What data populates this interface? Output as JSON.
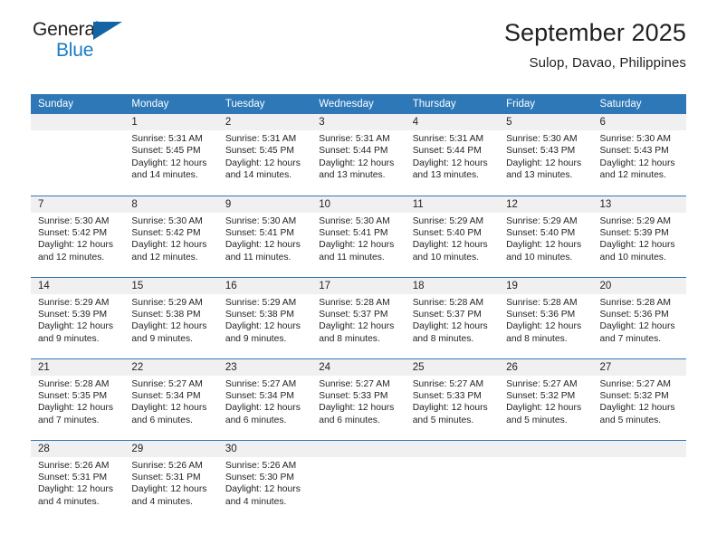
{
  "brand": {
    "name_part1": "General",
    "name_part2": "Blue",
    "triangle_icon": "triangle-icon",
    "accent_color": "#1a7dc4",
    "triangle_color": "#1464a5"
  },
  "header": {
    "title": "September 2025",
    "subtitle": "Sulop, Davao, Philippines"
  },
  "calendar": {
    "header_bg": "#2e78b8",
    "daynum_bg": "#f0f0f0",
    "weekday_headers": [
      "Sunday",
      "Monday",
      "Tuesday",
      "Wednesday",
      "Thursday",
      "Friday",
      "Saturday"
    ],
    "weeks": [
      [
        {
          "day": "",
          "sunrise": "",
          "sunset": "",
          "daylight": "",
          "daylight2": ""
        },
        {
          "day": "1",
          "sunrise": "Sunrise: 5:31 AM",
          "sunset": "Sunset: 5:45 PM",
          "daylight": "Daylight: 12 hours",
          "daylight2": "and 14 minutes."
        },
        {
          "day": "2",
          "sunrise": "Sunrise: 5:31 AM",
          "sunset": "Sunset: 5:45 PM",
          "daylight": "Daylight: 12 hours",
          "daylight2": "and 14 minutes."
        },
        {
          "day": "3",
          "sunrise": "Sunrise: 5:31 AM",
          "sunset": "Sunset: 5:44 PM",
          "daylight": "Daylight: 12 hours",
          "daylight2": "and 13 minutes."
        },
        {
          "day": "4",
          "sunrise": "Sunrise: 5:31 AM",
          "sunset": "Sunset: 5:44 PM",
          "daylight": "Daylight: 12 hours",
          "daylight2": "and 13 minutes."
        },
        {
          "day": "5",
          "sunrise": "Sunrise: 5:30 AM",
          "sunset": "Sunset: 5:43 PM",
          "daylight": "Daylight: 12 hours",
          "daylight2": "and 13 minutes."
        },
        {
          "day": "6",
          "sunrise": "Sunrise: 5:30 AM",
          "sunset": "Sunset: 5:43 PM",
          "daylight": "Daylight: 12 hours",
          "daylight2": "and 12 minutes."
        }
      ],
      [
        {
          "day": "7",
          "sunrise": "Sunrise: 5:30 AM",
          "sunset": "Sunset: 5:42 PM",
          "daylight": "Daylight: 12 hours",
          "daylight2": "and 12 minutes."
        },
        {
          "day": "8",
          "sunrise": "Sunrise: 5:30 AM",
          "sunset": "Sunset: 5:42 PM",
          "daylight": "Daylight: 12 hours",
          "daylight2": "and 12 minutes."
        },
        {
          "day": "9",
          "sunrise": "Sunrise: 5:30 AM",
          "sunset": "Sunset: 5:41 PM",
          "daylight": "Daylight: 12 hours",
          "daylight2": "and 11 minutes."
        },
        {
          "day": "10",
          "sunrise": "Sunrise: 5:30 AM",
          "sunset": "Sunset: 5:41 PM",
          "daylight": "Daylight: 12 hours",
          "daylight2": "and 11 minutes."
        },
        {
          "day": "11",
          "sunrise": "Sunrise: 5:29 AM",
          "sunset": "Sunset: 5:40 PM",
          "daylight": "Daylight: 12 hours",
          "daylight2": "and 10 minutes."
        },
        {
          "day": "12",
          "sunrise": "Sunrise: 5:29 AM",
          "sunset": "Sunset: 5:40 PM",
          "daylight": "Daylight: 12 hours",
          "daylight2": "and 10 minutes."
        },
        {
          "day": "13",
          "sunrise": "Sunrise: 5:29 AM",
          "sunset": "Sunset: 5:39 PM",
          "daylight": "Daylight: 12 hours",
          "daylight2": "and 10 minutes."
        }
      ],
      [
        {
          "day": "14",
          "sunrise": "Sunrise: 5:29 AM",
          "sunset": "Sunset: 5:39 PM",
          "daylight": "Daylight: 12 hours",
          "daylight2": "and 9 minutes."
        },
        {
          "day": "15",
          "sunrise": "Sunrise: 5:29 AM",
          "sunset": "Sunset: 5:38 PM",
          "daylight": "Daylight: 12 hours",
          "daylight2": "and 9 minutes."
        },
        {
          "day": "16",
          "sunrise": "Sunrise: 5:29 AM",
          "sunset": "Sunset: 5:38 PM",
          "daylight": "Daylight: 12 hours",
          "daylight2": "and 9 minutes."
        },
        {
          "day": "17",
          "sunrise": "Sunrise: 5:28 AM",
          "sunset": "Sunset: 5:37 PM",
          "daylight": "Daylight: 12 hours",
          "daylight2": "and 8 minutes."
        },
        {
          "day": "18",
          "sunrise": "Sunrise: 5:28 AM",
          "sunset": "Sunset: 5:37 PM",
          "daylight": "Daylight: 12 hours",
          "daylight2": "and 8 minutes."
        },
        {
          "day": "19",
          "sunrise": "Sunrise: 5:28 AM",
          "sunset": "Sunset: 5:36 PM",
          "daylight": "Daylight: 12 hours",
          "daylight2": "and 8 minutes."
        },
        {
          "day": "20",
          "sunrise": "Sunrise: 5:28 AM",
          "sunset": "Sunset: 5:36 PM",
          "daylight": "Daylight: 12 hours",
          "daylight2": "and 7 minutes."
        }
      ],
      [
        {
          "day": "21",
          "sunrise": "Sunrise: 5:28 AM",
          "sunset": "Sunset: 5:35 PM",
          "daylight": "Daylight: 12 hours",
          "daylight2": "and 7 minutes."
        },
        {
          "day": "22",
          "sunrise": "Sunrise: 5:27 AM",
          "sunset": "Sunset: 5:34 PM",
          "daylight": "Daylight: 12 hours",
          "daylight2": "and 6 minutes."
        },
        {
          "day": "23",
          "sunrise": "Sunrise: 5:27 AM",
          "sunset": "Sunset: 5:34 PM",
          "daylight": "Daylight: 12 hours",
          "daylight2": "and 6 minutes."
        },
        {
          "day": "24",
          "sunrise": "Sunrise: 5:27 AM",
          "sunset": "Sunset: 5:33 PM",
          "daylight": "Daylight: 12 hours",
          "daylight2": "and 6 minutes."
        },
        {
          "day": "25",
          "sunrise": "Sunrise: 5:27 AM",
          "sunset": "Sunset: 5:33 PM",
          "daylight": "Daylight: 12 hours",
          "daylight2": "and 5 minutes."
        },
        {
          "day": "26",
          "sunrise": "Sunrise: 5:27 AM",
          "sunset": "Sunset: 5:32 PM",
          "daylight": "Daylight: 12 hours",
          "daylight2": "and 5 minutes."
        },
        {
          "day": "27",
          "sunrise": "Sunrise: 5:27 AM",
          "sunset": "Sunset: 5:32 PM",
          "daylight": "Daylight: 12 hours",
          "daylight2": "and 5 minutes."
        }
      ],
      [
        {
          "day": "28",
          "sunrise": "Sunrise: 5:26 AM",
          "sunset": "Sunset: 5:31 PM",
          "daylight": "Daylight: 12 hours",
          "daylight2": "and 4 minutes."
        },
        {
          "day": "29",
          "sunrise": "Sunrise: 5:26 AM",
          "sunset": "Sunset: 5:31 PM",
          "daylight": "Daylight: 12 hours",
          "daylight2": "and 4 minutes."
        },
        {
          "day": "30",
          "sunrise": "Sunrise: 5:26 AM",
          "sunset": "Sunset: 5:30 PM",
          "daylight": "Daylight: 12 hours",
          "daylight2": "and 4 minutes."
        },
        {
          "day": "",
          "sunrise": "",
          "sunset": "",
          "daylight": "",
          "daylight2": ""
        },
        {
          "day": "",
          "sunrise": "",
          "sunset": "",
          "daylight": "",
          "daylight2": ""
        },
        {
          "day": "",
          "sunrise": "",
          "sunset": "",
          "daylight": "",
          "daylight2": ""
        },
        {
          "day": "",
          "sunrise": "",
          "sunset": "",
          "daylight": "",
          "daylight2": ""
        }
      ]
    ]
  }
}
